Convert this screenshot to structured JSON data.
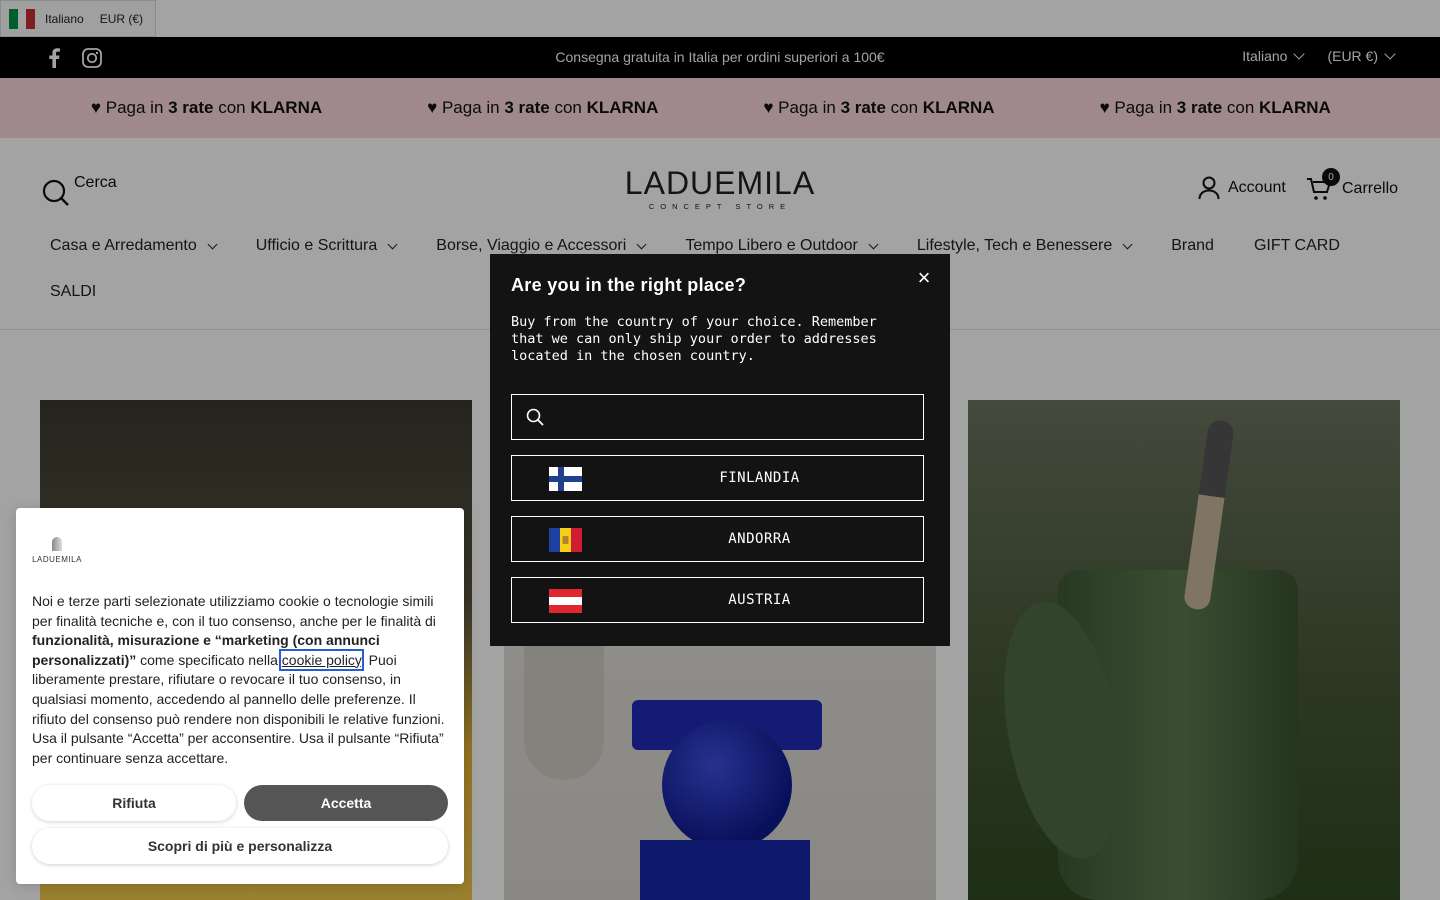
{
  "lang_bar": {
    "language": "Italiano",
    "currency": "EUR (€)"
  },
  "announcement": {
    "text": "Consegna gratuita in Italia per ordini superiori a 100€",
    "language_label": "Italiano",
    "currency_label": "(EUR €)",
    "social": [
      "facebook-icon",
      "instagram-icon"
    ]
  },
  "marquee": {
    "items": [
      {
        "prefix": "",
        "mid": "",
        "post": "con ",
        "brand": "KLARNA"
      },
      {
        "prefix": "♥ Paga in ",
        "mid": "3 rate",
        "post": " con ",
        "brand": "KLARNA"
      },
      {
        "prefix": "♥ Paga in ",
        "mid": "3 rate",
        "post": " con ",
        "brand": "KLARNA"
      },
      {
        "prefix": "♥ Paga in ",
        "mid": "3 rate",
        "post": " con ",
        "brand": "KLARNA"
      },
      {
        "prefix": "♥ Paga in ",
        "mid": "3 rate",
        "post": " con ",
        "brand": "KLARNA"
      }
    ]
  },
  "header": {
    "search_label": "Cerca",
    "logo_main": "LADUEMILA",
    "logo_sub": "CONCEPT STORE",
    "account_label": "Account",
    "cart_label": "Carrello",
    "cart_count": "0"
  },
  "nav": {
    "row1": [
      {
        "label": "Casa e Arredamento",
        "dropdown": true
      },
      {
        "label": "Ufficio e Scrittura",
        "dropdown": true
      },
      {
        "label": "Borse, Viaggio e Accessori",
        "dropdown": true
      },
      {
        "label": "Tempo Libero e Outdoor",
        "dropdown": true
      },
      {
        "label": "Lifestyle, Tech e Benessere",
        "dropdown": true
      },
      {
        "label": "Brand",
        "dropdown": false
      },
      {
        "label": "GIFT CARD",
        "dropdown": false
      }
    ],
    "row2": [
      {
        "label": "SALDI",
        "dropdown": false
      }
    ]
  },
  "country_modal": {
    "title": "Are you in the right place?",
    "description": "Buy from the country of your choice. Remember that we can only ship your order to addresses located in the chosen country.",
    "search_placeholder": "",
    "countries": [
      "FINLANDIA",
      "ANDORRA",
      "AUSTRIA"
    ]
  },
  "cookie": {
    "logo_text": "LADUEMILA",
    "text_1": "Noi e terze parti selezionate utilizziamo cookie o tecnologie simili per finalità tecniche e, con il tuo consenso, anche per le finalità di ",
    "text_bold": "funzionalità, misurazione e “marketing (con annunci personalizzati)”",
    "text_2": " come specificato nella ",
    "link": "cookie policy",
    "text_3": ". Puoi liberamente prestare, rifiutare o revocare il tuo consenso, in qualsiasi momento, accedendo al pannello delle preferenze. Il rifiuto del consenso può rendere non disponibili le relative funzioni. Usa il pulsante “Accetta” per acconsentire. Usa il pulsante “Rifiuta” per continuare senza accettare.",
    "reject_label": "Rifiuta",
    "accept_label": "Accetta",
    "customize_label": "Scopri di più e personalizza"
  },
  "colors": {
    "announcement_bg": "#000000",
    "marquee_bg": "#fbd6dc",
    "modal_bg": "#131313",
    "accept_bg": "#555555"
  }
}
